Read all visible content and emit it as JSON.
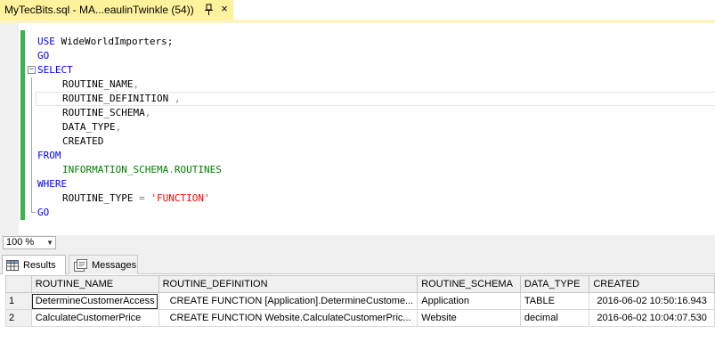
{
  "tab": {
    "title": "MyTecBits.sql - MA...eaulinTwinkle (54))",
    "pin_icon": "pin-icon",
    "close_icon": "close-icon",
    "accent": "#fff29d"
  },
  "editor": {
    "fold_icon": "collapse-icon",
    "fold_glyph": "−",
    "lines": [
      {
        "parts": [
          {
            "t": "USE",
            "c": "kw"
          },
          {
            "t": " WideWorldImporters;",
            "c": "txt"
          }
        ]
      },
      {
        "parts": [
          {
            "t": "GO",
            "c": "kw"
          }
        ]
      },
      {
        "parts": [
          {
            "t": "SELECT",
            "c": "kw"
          }
        ]
      },
      {
        "indent": true,
        "parts": [
          {
            "t": "ROUTINE_NAME",
            "c": "txt"
          },
          {
            "t": ",",
            "c": "op"
          }
        ]
      },
      {
        "indent": true,
        "parts": [
          {
            "t": "ROUTINE_DEFINITION ",
            "c": "txt"
          },
          {
            "t": ",",
            "c": "op"
          }
        ]
      },
      {
        "indent": true,
        "parts": [
          {
            "t": "ROUTINE_SCHEMA",
            "c": "txt"
          },
          {
            "t": ",",
            "c": "op"
          }
        ]
      },
      {
        "indent": true,
        "parts": [
          {
            "t": "DATA_TYPE",
            "c": "txt"
          },
          {
            "t": ",",
            "c": "op"
          }
        ]
      },
      {
        "indent": true,
        "parts": [
          {
            "t": "CREATED",
            "c": "txt"
          }
        ]
      },
      {
        "parts": [
          {
            "t": "FROM",
            "c": "kw"
          }
        ]
      },
      {
        "indent": true,
        "parts": [
          {
            "t": "INFORMATION_SCHEMA",
            "c": "sys"
          },
          {
            "t": ".",
            "c": "op"
          },
          {
            "t": "ROUTINES",
            "c": "sys"
          }
        ]
      },
      {
        "parts": [
          {
            "t": "WHERE",
            "c": "kw"
          }
        ]
      },
      {
        "indent": true,
        "parts": [
          {
            "t": "ROUTINE_TYPE ",
            "c": "txt"
          },
          {
            "t": "=",
            "c": "op"
          },
          {
            "t": " ",
            "c": "txt"
          },
          {
            "t": "'FUNCTION'",
            "c": "str"
          }
        ]
      },
      {
        "parts": [
          {
            "t": "GO",
            "c": "kw"
          }
        ]
      }
    ]
  },
  "zoom": {
    "value": "100 %",
    "arrow": "▼"
  },
  "results_tabs": [
    {
      "label": "Results",
      "icon": "grid-icon",
      "active": true
    },
    {
      "label": "Messages",
      "icon": "messages-icon",
      "active": false
    }
  ],
  "grid": {
    "columns": [
      "ROUTINE_NAME",
      "ROUTINE_DEFINITION",
      "ROUTINE_SCHEMA",
      "DATA_TYPE",
      "CREATED"
    ],
    "rows": [
      {
        "num": "1",
        "cells": [
          "DetermineCustomerAccess",
          "CREATE FUNCTION [Application].DetermineCustome...",
          "Application",
          "TABLE",
          "2016-06-02 10:50:16.943"
        ]
      },
      {
        "num": "2",
        "cells": [
          "CalculateCustomerPrice",
          "CREATE FUNCTION Website.CalculateCustomerPric...",
          "Website",
          "decimal",
          "2016-06-02 10:04:07.530"
        ]
      }
    ]
  }
}
